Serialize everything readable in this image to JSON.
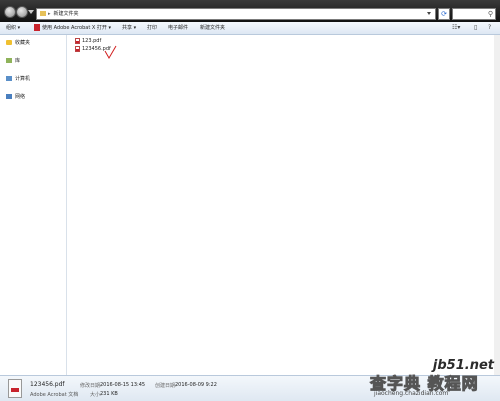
{
  "address": {
    "separator": "▸",
    "path": "新建文件夹"
  },
  "toolbar": {
    "organize": "组织 ▾",
    "open_with": "使用 Adobe Acrobat X 打开 ▾",
    "share": "共享 ▾",
    "print": "打印",
    "email": "电子邮件",
    "new_folder": "新建文件夹"
  },
  "sidebar": {
    "favorites": "收藏夹",
    "library": "库",
    "computer": "计算机",
    "network": "网络"
  },
  "files": [
    {
      "name": "123.pdf"
    },
    {
      "name": "123456.pdf"
    }
  ],
  "details": {
    "name": "123456.pdf",
    "type": "Adobe Acrobat 文档",
    "modified_label": "修改日期:",
    "modified_value": "2016-08-15 13:45",
    "created_label": "创建日期:",
    "created_value": "2016-08-09 9:22",
    "size_label": "大小:",
    "size_value": "231 KB"
  },
  "watermark": {
    "domain": "jb51.net",
    "brand": "查字典 教程网",
    "url": "jiaocheng.chazidian.com"
  },
  "colors": {
    "pdf_red": "#c8232c",
    "titlebar": "#1a1a1a",
    "checkmark": "#d22020"
  }
}
